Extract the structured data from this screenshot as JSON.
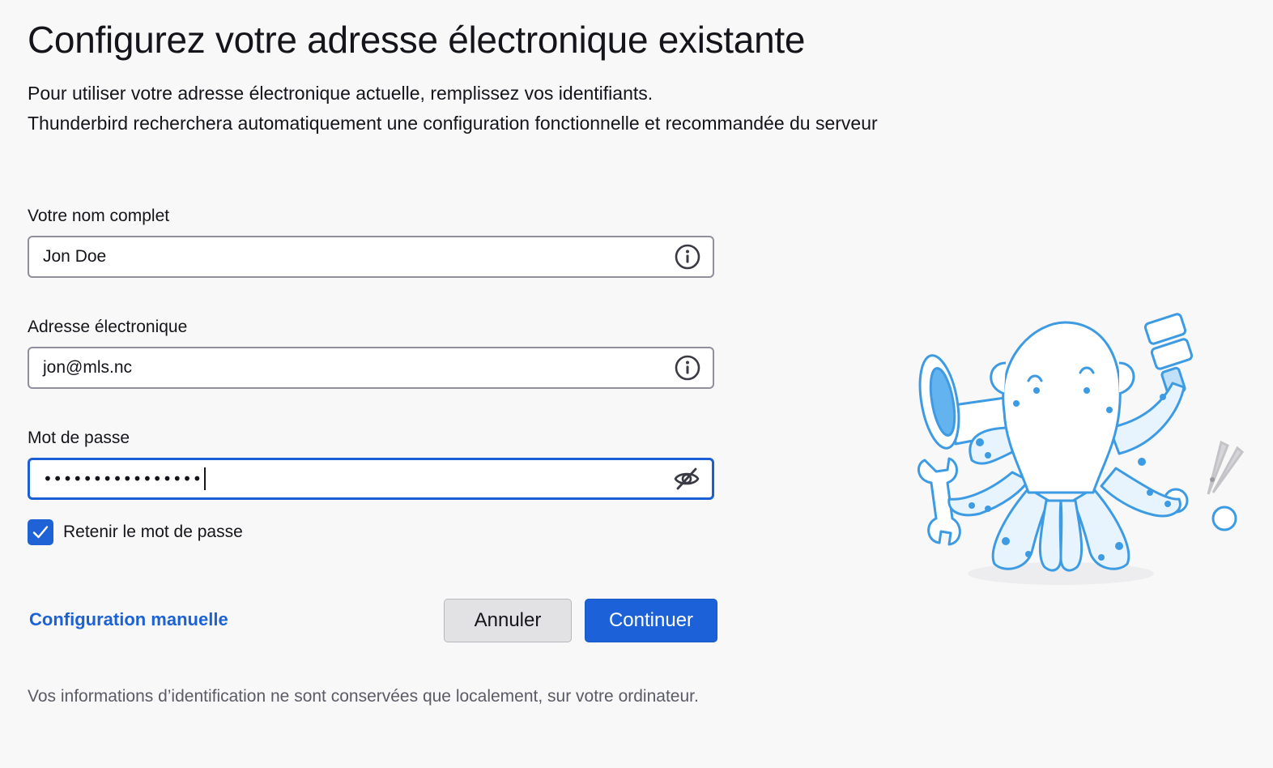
{
  "header": {
    "title": "Configurez votre adresse électronique existante",
    "intro_line1": "Pour utiliser votre adresse électronique actuelle, remplissez vos identifiants.",
    "intro_line2": "Thunderbird recherchera automatiquement une configuration fonctionnelle et recommandée du serveur"
  },
  "form": {
    "name": {
      "label": "Votre nom complet",
      "value": "Jon Doe",
      "icon": "info-icon"
    },
    "email": {
      "label": "Adresse électronique",
      "value": "jon@mls.nc",
      "icon": "info-icon"
    },
    "password": {
      "label": "Mot de passe",
      "masked_value": "••••••••••••••••",
      "icon": "eye-slash-icon"
    },
    "remember": {
      "label": "Retenir le mot de passe",
      "checked": true
    }
  },
  "actions": {
    "manual_config": "Configuration manuelle",
    "cancel": "Annuler",
    "continue": "Continuer"
  },
  "footnote": "Vos informations d’identification ne sont conservées que localement, sur votre ordinateur.",
  "colors": {
    "accent": "#1d61d8",
    "link": "#1a62d6",
    "background": "#f8f8f8",
    "illustration_blue": "#4aa3e6"
  }
}
